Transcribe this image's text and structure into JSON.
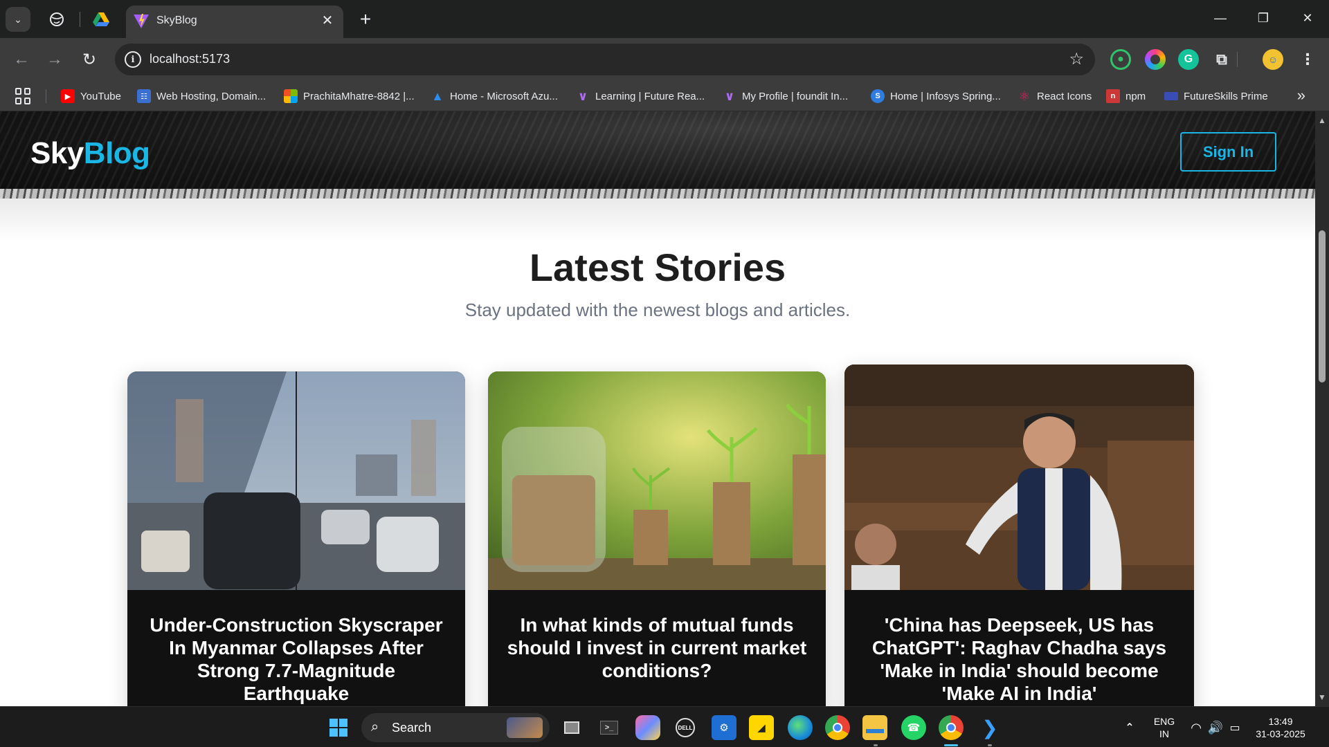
{
  "browser": {
    "tab_title": "SkyBlog",
    "url": "localhost:5173",
    "bookmarks": [
      {
        "label": "YouTube",
        "color": "#ff0000"
      },
      {
        "label": "Web Hosting, Domain...",
        "color": "#3b6fd1"
      },
      {
        "label": "PrachitaMhatre-8842 |...",
        "color": "#f25022"
      },
      {
        "label": "Home - Microsoft Azu...",
        "color": "#0078d4"
      },
      {
        "label": "Learning | Future Rea...",
        "color": "#7b3fc7"
      },
      {
        "label": "My Profile | foundit In...",
        "color": "#7b3fc7"
      },
      {
        "label": "Home | Infosys Spring...",
        "color": "#2f7de1"
      },
      {
        "label": "React Icons",
        "color": "#e91e63"
      },
      {
        "label": "npm",
        "color": "#cb3837"
      },
      {
        "label": "FutureSkills Prime",
        "color": "#3a4db5"
      }
    ]
  },
  "site": {
    "logo_part1": "Sky",
    "logo_part2": "Blog",
    "signin_label": "Sign In",
    "heading": "Latest Stories",
    "subheading": "Stay updated with the newest blogs and articles.",
    "accent_color": "#19b6e6",
    "cards": [
      {
        "title": "Under-Construction Skyscraper In Myanmar Collapses After Strong 7.7-Magnitude Earthquake",
        "image": "street-traffic-collapse-photo"
      },
      {
        "title": "In what kinds of mutual funds should I invest in current market conditions?",
        "image": "coins-plants-photo"
      },
      {
        "title": "'China has Deepseek, US has ChatGPT': Raghav Chadha says 'Make in India' should become 'Make AI in India'",
        "image": "parliament-speaker-photo"
      }
    ]
  },
  "taskbar": {
    "search_label": "Search",
    "lang_line1": "ENG",
    "lang_line2": "IN",
    "time": "13:49",
    "date": "31-03-2025"
  }
}
